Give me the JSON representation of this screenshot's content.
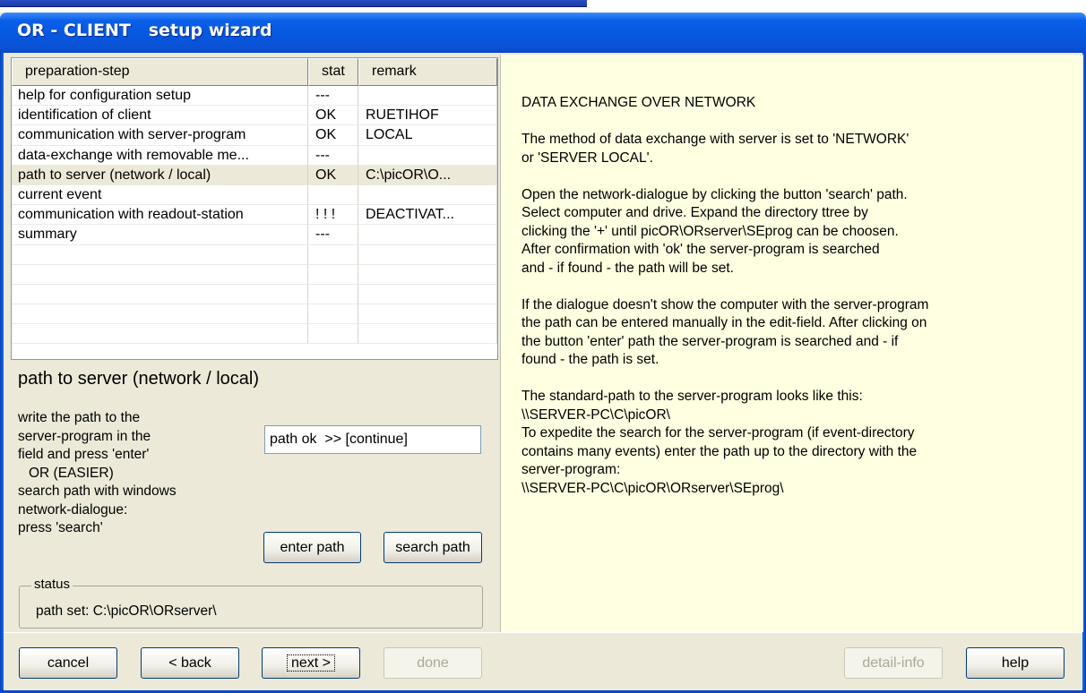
{
  "window": {
    "title": "OR - CLIENT   setup wizard",
    "colors": {
      "titlebar": "#0758e0",
      "help_bg": "#ffffe1",
      "dialog_bg": "#ece9d8"
    }
  },
  "grid": {
    "columns": [
      "preparation-step",
      "stat",
      "remark"
    ],
    "rows": [
      {
        "step": "help for configuration setup",
        "stat": "---",
        "remark": ""
      },
      {
        "step": "identification of client",
        "stat": "OK",
        "remark": "RUETIHOF"
      },
      {
        "step": "communication with server-program",
        "stat": "OK",
        "remark": "LOCAL"
      },
      {
        "step": "data-exchange with removable me...",
        "stat": "---",
        "remark": ""
      },
      {
        "step": "path to server (network / local)",
        "stat": "OK",
        "remark": "C:\\picOR\\O..."
      },
      {
        "step": "current event",
        "stat": "",
        "remark": ""
      },
      {
        "step": "communication with readout-station",
        "stat": "! ! !",
        "remark": "DEACTIVAT..."
      },
      {
        "step": "summary",
        "stat": "---",
        "remark": ""
      },
      {
        "step": "",
        "stat": "",
        "remark": ""
      },
      {
        "step": "",
        "stat": "",
        "remark": ""
      },
      {
        "step": "",
        "stat": "",
        "remark": ""
      },
      {
        "step": "",
        "stat": "",
        "remark": ""
      },
      {
        "step": "",
        "stat": "",
        "remark": ""
      }
    ],
    "selected_index": 4
  },
  "step_panel": {
    "title": "path to server (network / local)",
    "instructions": [
      "write the path to the",
      "server-program in the",
      "field and press 'enter'",
      "OR (EASIER)",
      "search path with windows",
      "network-dialogue:",
      "press 'search'"
    ],
    "path_field_value": "path ok  >> [continue]",
    "enter_path_label": "enter path",
    "search_path_label": "search path",
    "status_legend": "status",
    "status_text": "path set: C:\\picOR\\ORserver\\"
  },
  "help": {
    "paragraphs": [
      "DATA EXCHANGE OVER NETWORK",
      "The method of data exchange with server is set to 'NETWORK'\nor 'SERVER LOCAL'.",
      "Open the network-dialogue by clicking the button 'search' path.\nSelect computer and drive. Expand the directory ttree by\nclicking the '+' until picOR\\ORserver\\SEprog can be choosen.\nAfter confirmation with 'ok' the server-program is searched\nand - if found - the path will be set.",
      "If the dialogue doesn't show the computer with the server-program\nthe path can be entered manually in the edit-field. After clicking on\nthe button 'enter' path the server-program is searched and - if\nfound - the path is set.",
      "The standard-path to the server-program looks like this:\n\\\\SERVER-PC\\C\\picOR\\\nTo expedite the search for the server-program (if event-directory\ncontains many events) enter the path up to the directory with the\nserver-program:\n\\\\SERVER-PC\\C\\picOR\\ORserver\\SEprog\\"
    ]
  },
  "buttons": {
    "cancel": "cancel",
    "back": "< back",
    "next": "next >",
    "done": "done",
    "detail_info": "detail-info",
    "help": "help"
  }
}
